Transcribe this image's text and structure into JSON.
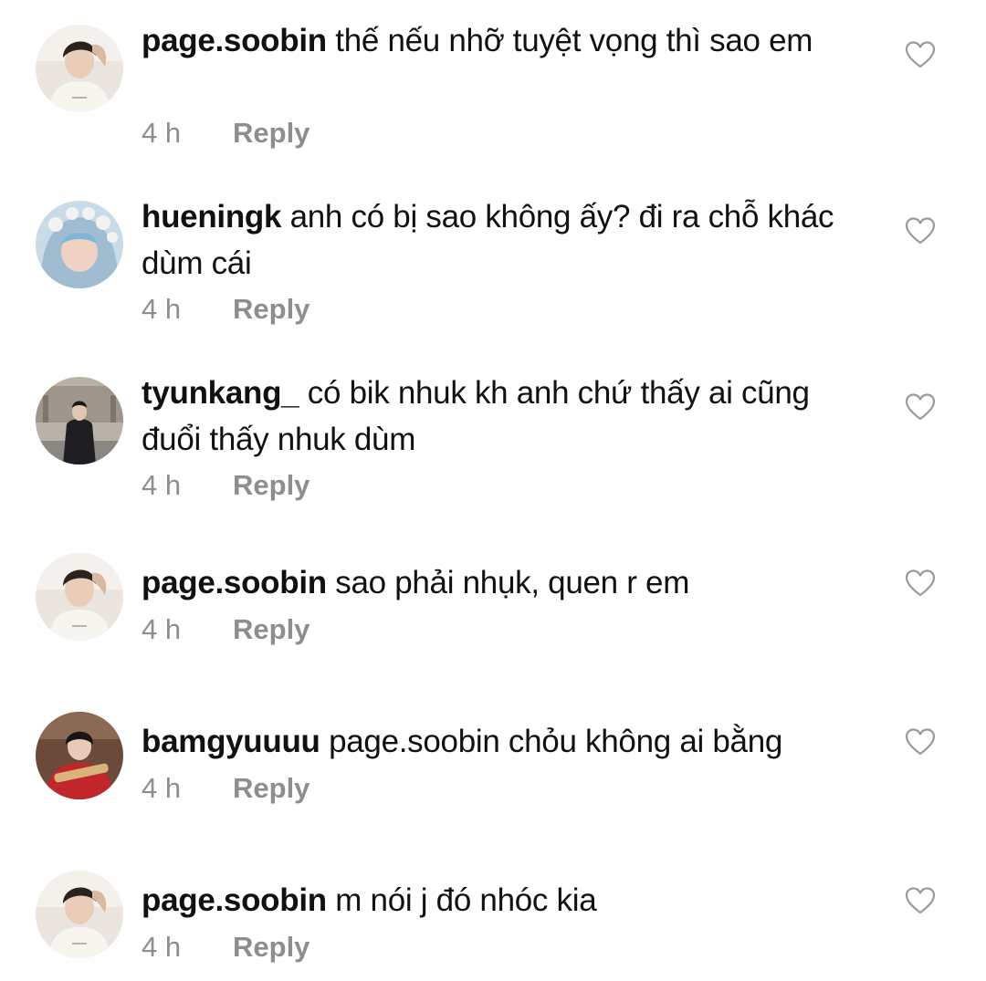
{
  "comments": [
    {
      "username": "page.soobin",
      "text": "thế nếu nhỡ tuyệt vọng thì sao em",
      "time": "4 h",
      "reply_label": "Reply",
      "avatar_icon": "profile-photo-icon"
    },
    {
      "username": "hueningk",
      "text": "anh có bị sao không ấy? đi ra chỗ khác dùm cái",
      "time": "4 h",
      "reply_label": "Reply",
      "avatar_icon": "profile-photo-icon"
    },
    {
      "username": "tyunkang_",
      "text": "có bik nhuk kh anh chứ thấy ai cũng đuổi thấy nhuk dùm",
      "time": "4 h",
      "reply_label": "Reply",
      "avatar_icon": "profile-photo-icon"
    },
    {
      "username": "page.soobin",
      "text": "sao phải nhụk, quen r em",
      "time": "4 h",
      "reply_label": "Reply",
      "avatar_icon": "profile-photo-icon"
    },
    {
      "username": "bamgyuuuu",
      "text": "page.soobin chỏu không ai bằng",
      "time": "4 h",
      "reply_label": "Reply",
      "avatar_icon": "profile-photo-icon"
    },
    {
      "username": "page.soobin",
      "text": "m nói j đó nhóc kia",
      "time": "4 h",
      "reply_label": "Reply",
      "avatar_icon": "profile-photo-icon"
    }
  ],
  "like_icon": "heart-outline-icon",
  "colors": {
    "text": "#111111",
    "meta": "#8e8e8e",
    "icon": "#9a9a9a",
    "background": "#ffffff"
  }
}
